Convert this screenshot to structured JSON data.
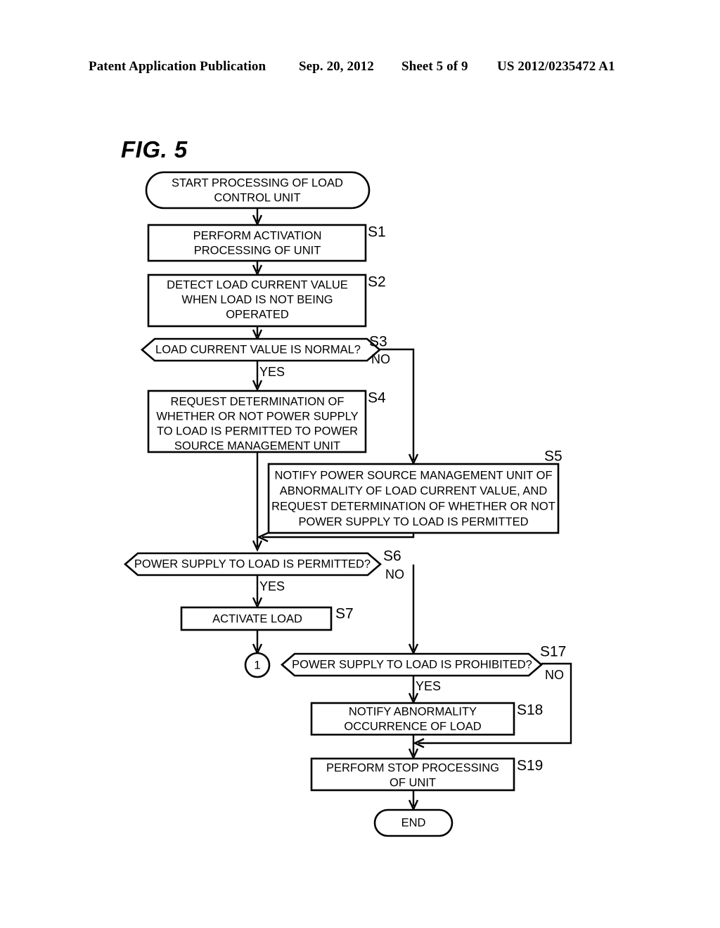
{
  "header": {
    "title": "Patent Application Publication",
    "date": "Sep. 20, 2012",
    "sheet": "Sheet 5 of 9",
    "patent_number": "US 2012/0235472 A1"
  },
  "figure": {
    "label": "FIG. 5"
  },
  "flowchart": {
    "type": "flowchart",
    "nodes": [
      {
        "id": "start",
        "shape": "terminator",
        "tag": "",
        "lines": [
          "START PROCESSING OF LOAD",
          "CONTROL UNIT"
        ]
      },
      {
        "id": "s1",
        "shape": "process",
        "tag": "S1",
        "lines": [
          "PERFORM ACTIVATION",
          "PROCESSING OF UNIT"
        ]
      },
      {
        "id": "s2",
        "shape": "process",
        "tag": "S2",
        "lines": [
          "DETECT LOAD CURRENT VALUE",
          "WHEN LOAD IS NOT BEING",
          "OPERATED"
        ]
      },
      {
        "id": "s3",
        "shape": "decision",
        "tag": "S3",
        "lines": [
          "LOAD CURRENT VALUE IS NORMAL?"
        ]
      },
      {
        "id": "s4",
        "shape": "process",
        "tag": "S4",
        "lines": [
          "REQUEST DETERMINATION OF",
          "WHETHER OR NOT POWER SUPPLY",
          "TO LOAD IS PERMITTED TO POWER",
          "SOURCE MANAGEMENT UNIT"
        ]
      },
      {
        "id": "s5",
        "shape": "process",
        "tag": "S5",
        "lines": [
          "NOTIFY POWER SOURCE MANAGEMENT UNIT OF",
          "ABNORMALITY OF LOAD CURRENT VALUE, AND",
          "REQUEST DETERMINATION OF WHETHER OR NOT",
          "POWER SUPPLY TO LOAD IS PERMITTED"
        ]
      },
      {
        "id": "s6",
        "shape": "decision",
        "tag": "S6",
        "lines": [
          "POWER SUPPLY TO LOAD IS PERMITTED?"
        ]
      },
      {
        "id": "s7",
        "shape": "process",
        "tag": "S7",
        "lines": [
          "ACTIVATE LOAD"
        ]
      },
      {
        "id": "conn1",
        "shape": "connector",
        "tag": "",
        "lines": [
          "1"
        ]
      },
      {
        "id": "s17",
        "shape": "decision",
        "tag": "S17",
        "lines": [
          "POWER SUPPLY TO LOAD IS PROHIBITED?"
        ]
      },
      {
        "id": "s18",
        "shape": "process",
        "tag": "S18",
        "lines": [
          "NOTIFY ABNORMALITY",
          "OCCURRENCE OF LOAD"
        ]
      },
      {
        "id": "s19",
        "shape": "process",
        "tag": "S19",
        "lines": [
          "PERFORM STOP PROCESSING",
          "OF UNIT"
        ]
      },
      {
        "id": "end",
        "shape": "terminator",
        "tag": "",
        "lines": [
          "END"
        ]
      }
    ],
    "branch_labels": {
      "s3_yes": "YES",
      "s3_no": "NO",
      "s6_yes": "YES",
      "s6_no": "NO",
      "s17_yes": "YES",
      "s17_no": "NO"
    }
  }
}
